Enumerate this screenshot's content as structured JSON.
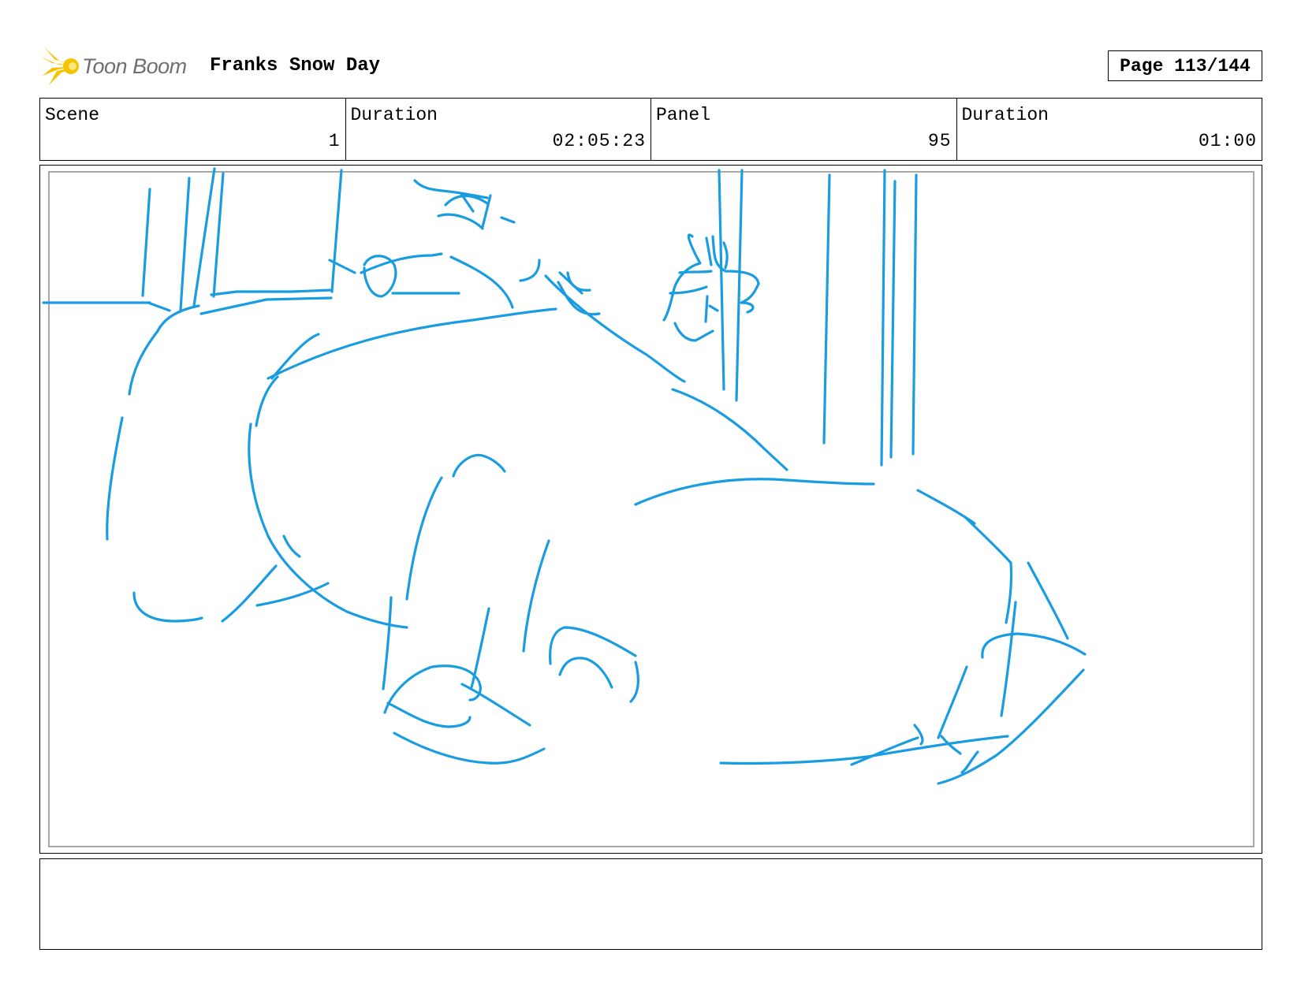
{
  "header": {
    "logo_text": "Toon Boom",
    "project_title": "Franks Snow Day",
    "page_label": "Page 113/144"
  },
  "info": [
    {
      "label": "Scene",
      "value": "1"
    },
    {
      "label": "Duration",
      "value": "02:05:23"
    },
    {
      "label": "Panel",
      "value": "95"
    },
    {
      "label": "Duration",
      "value": "01:00"
    }
  ],
  "panel": {
    "stroke_color": "#1a9de0",
    "frame_color": "#a8a8a8"
  },
  "logo_colors": {
    "burst": "#f5c400",
    "text": "#6f6f6f"
  },
  "notes": {
    "text": ""
  }
}
